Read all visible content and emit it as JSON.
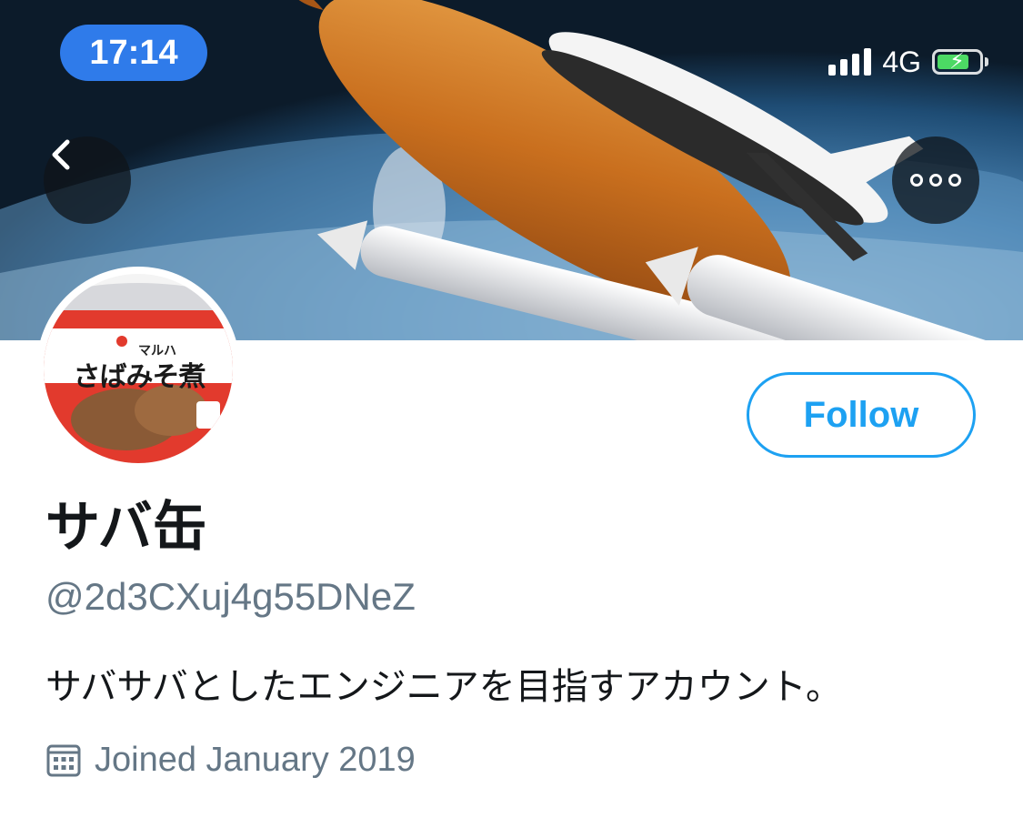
{
  "status_bar": {
    "time": "17:14",
    "network": "4G",
    "icons": [
      "signal-bars-icon",
      "battery-charging-icon"
    ]
  },
  "header": {
    "back_icon": "back-chevron-icon",
    "more_icon": "more-dots-icon"
  },
  "avatar": {
    "brand_text": "マルハ",
    "product_text": "さばみそ煮"
  },
  "profile": {
    "follow_label": "Follow",
    "display_name": "サバ缶",
    "handle": "@2d3CXuj4g55DNeZ",
    "bio": "サバサバとしたエンジニアを目指すアカウント。",
    "joined_icon": "calendar-icon",
    "joined": "Joined January 2019"
  },
  "colors": {
    "accent": "#1da1f2",
    "time_pill": "#2f7bea",
    "muted_text": "#657786",
    "text": "#14171a"
  }
}
